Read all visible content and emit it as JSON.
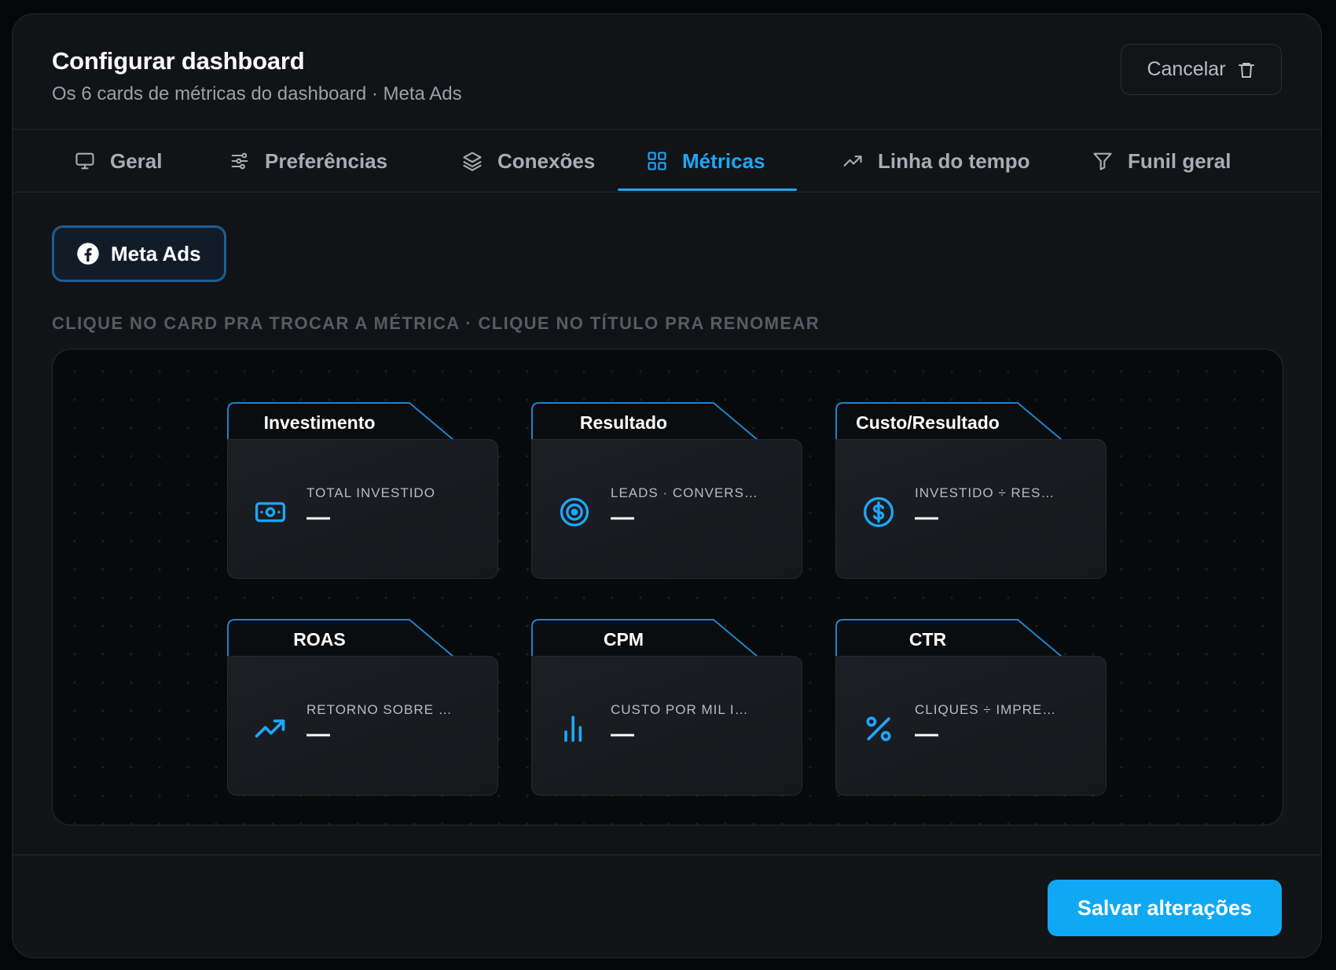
{
  "header": {
    "title": "Configurar dashboard",
    "subtitle": "Os 6 cards de métricas do dashboard · Meta Ads",
    "cancel_label": "Cancelar"
  },
  "tabs": [
    {
      "label": "Geral",
      "icon": "monitor-icon",
      "active": false
    },
    {
      "label": "Preferências",
      "icon": "sliders-icon",
      "active": false
    },
    {
      "label": "Conexões",
      "icon": "layers-icon",
      "active": false
    },
    {
      "label": "Métricas",
      "icon": "grid-icon",
      "active": true
    },
    {
      "label": "Linha do tempo",
      "icon": "trending-up-icon",
      "active": false
    },
    {
      "label": "Funil geral",
      "icon": "filter-icon",
      "active": false
    }
  ],
  "platform": {
    "label": "Meta Ads",
    "icon": "facebook-icon"
  },
  "hint": "CLIQUE NO CARD PRA TROCAR A MÉTRICA · CLIQUE NO TÍTULO PRA RENOMEAR",
  "cards": [
    {
      "title": "Investimento",
      "metric": "TOTAL INVESTIDO",
      "value": "—",
      "icon": "money-icon"
    },
    {
      "title": "Resultado",
      "metric": "LEADS · CONVERS…",
      "value": "—",
      "icon": "target-icon"
    },
    {
      "title": "Custo/Resultado",
      "metric": "INVESTIDO ÷ RES…",
      "value": "—",
      "icon": "dollar-circle-icon"
    },
    {
      "title": "ROAS",
      "metric": "RETORNO SOBRE …",
      "value": "—",
      "icon": "trending-up-icon"
    },
    {
      "title": "CPM",
      "metric": "CUSTO POR MIL I…",
      "value": "—",
      "icon": "bar-chart-icon"
    },
    {
      "title": "CTR",
      "metric": "CLIQUES ÷ IMPRE…",
      "value": "—",
      "icon": "percent-icon"
    }
  ],
  "footer": {
    "save_label": "Salvar alterações"
  },
  "colors": {
    "accent": "#1ea7ff",
    "save_button": "#0fa8f5",
    "background": "#111316"
  }
}
